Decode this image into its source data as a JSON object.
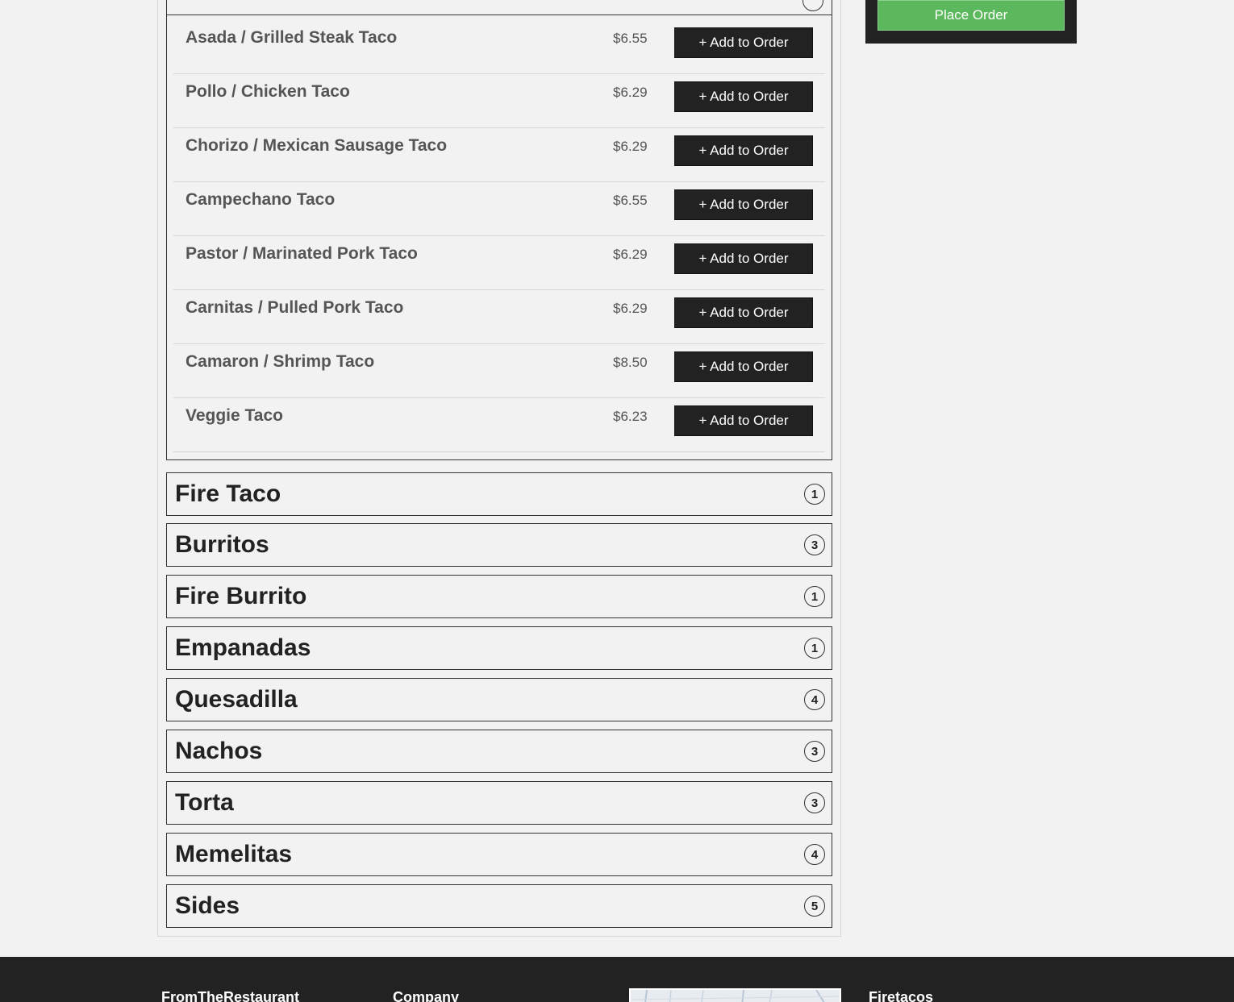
{
  "menu": {
    "items": [
      {
        "name": "Asada / Grilled Steak Taco",
        "price": "$6.55",
        "button": "+ Add to Order"
      },
      {
        "name": "Pollo / Chicken Taco",
        "price": "$6.29",
        "button": "+ Add to Order"
      },
      {
        "name": "Chorizo / Mexican Sausage Taco",
        "price": "$6.29",
        "button": "+ Add to Order"
      },
      {
        "name": "Campechano Taco",
        "price": "$6.55",
        "button": "+ Add to Order"
      },
      {
        "name": "Pastor / Marinated Pork Taco",
        "price": "$6.29",
        "button": "+ Add to Order"
      },
      {
        "name": "Carnitas / Pulled Pork Taco",
        "price": "$6.29",
        "button": "+ Add to Order"
      },
      {
        "name": "Camaron / Shrimp Taco",
        "price": "$8.50",
        "button": "+ Add to Order"
      },
      {
        "name": "Veggie Taco",
        "price": "$6.23",
        "button": "+ Add to Order"
      }
    ],
    "categories": [
      {
        "name": "Fire Taco",
        "count": "1"
      },
      {
        "name": "Burritos",
        "count": "3"
      },
      {
        "name": "Fire Burrito",
        "count": "1"
      },
      {
        "name": "Empanadas",
        "count": "1"
      },
      {
        "name": "Quesadilla",
        "count": "4"
      },
      {
        "name": "Nachos",
        "count": "3"
      },
      {
        "name": "Torta",
        "count": "3"
      },
      {
        "name": "Memelitas",
        "count": "4"
      },
      {
        "name": "Sides",
        "count": "5"
      }
    ]
  },
  "order": {
    "place_order_label": "Place Order"
  },
  "footer": {
    "col1_heading": "FromTheRestaurant",
    "col2_heading": "Company",
    "col4_heading": "Firetacos"
  },
  "colors": {
    "accent_green": "#5cb85c",
    "dark": "#222222"
  }
}
